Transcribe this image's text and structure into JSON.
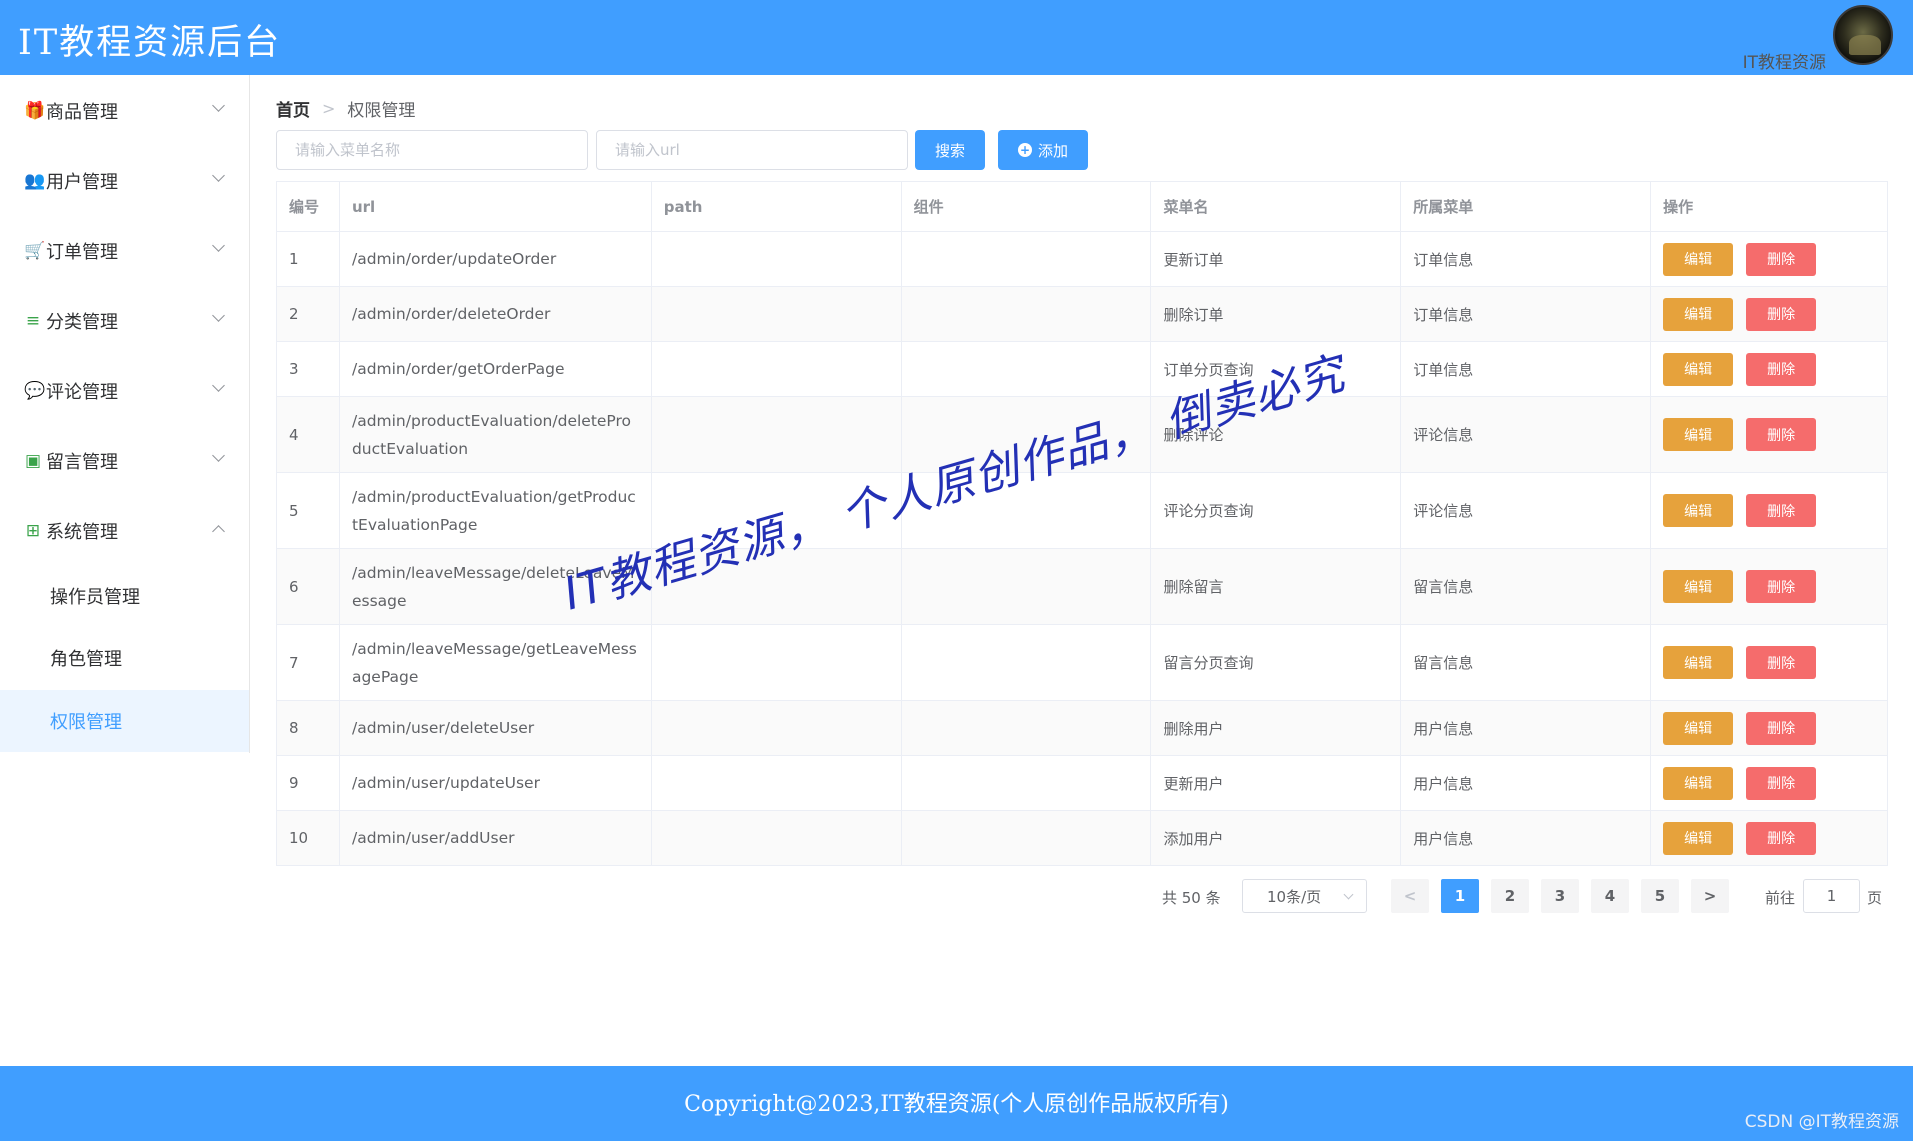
{
  "header": {
    "title": "IT教程资源后台",
    "user_name": "IT教程资源"
  },
  "sidebar": {
    "items": [
      {
        "label": "商品管理",
        "icon": "gift-icon",
        "glyph": "🎁"
      },
      {
        "label": "用户管理",
        "icon": "users-icon",
        "glyph": "👥"
      },
      {
        "label": "订单管理",
        "icon": "cart-icon",
        "glyph": "🛒"
      },
      {
        "label": "分类管理",
        "icon": "list-icon",
        "glyph": "≡"
      },
      {
        "label": "评论管理",
        "icon": "comment-icon",
        "glyph": "💬"
      },
      {
        "label": "留言管理",
        "icon": "message-icon",
        "glyph": "▣"
      },
      {
        "label": "系统管理",
        "icon": "windows-icon",
        "glyph": "⊞"
      }
    ],
    "sub_items": [
      {
        "label": "操作员管理"
      },
      {
        "label": "角色管理"
      },
      {
        "label": "权限管理"
      }
    ]
  },
  "breadcrumb": {
    "home": "首页",
    "separator": ">",
    "current": "权限管理"
  },
  "search": {
    "menu_placeholder": "请输入菜单名称",
    "url_placeholder": "请输入url",
    "search_label": "搜索",
    "add_label": "添加"
  },
  "table": {
    "columns": [
      "编号",
      "url",
      "path",
      "组件",
      "菜单名",
      "所属菜单",
      "操作"
    ],
    "edit_label": "编辑",
    "delete_label": "删除",
    "rows": [
      {
        "id": "1",
        "url": "/admin/order/updateOrder",
        "path": "",
        "component": "",
        "menu_name": "更新订单",
        "parent": "订单信息"
      },
      {
        "id": "2",
        "url": "/admin/order/deleteOrder",
        "path": "",
        "component": "",
        "menu_name": "删除订单",
        "parent": "订单信息"
      },
      {
        "id": "3",
        "url": "/admin/order/getOrderPage",
        "path": "",
        "component": "",
        "menu_name": "订单分页查询",
        "parent": "订单信息"
      },
      {
        "id": "4",
        "url": "/admin/productEvaluation/deleteProductEvaluation",
        "path": "",
        "component": "",
        "menu_name": "删除评论",
        "parent": "评论信息"
      },
      {
        "id": "5",
        "url": "/admin/productEvaluation/getProductEvaluationPage",
        "path": "",
        "component": "",
        "menu_name": "评论分页查询",
        "parent": "评论信息"
      },
      {
        "id": "6",
        "url": "/admin/leaveMessage/deleteLeaveMessage",
        "path": "",
        "component": "",
        "menu_name": "删除留言",
        "parent": "留言信息"
      },
      {
        "id": "7",
        "url": "/admin/leaveMessage/getLeaveMessagePage",
        "path": "",
        "component": "",
        "menu_name": "留言分页查询",
        "parent": "留言信息"
      },
      {
        "id": "8",
        "url": "/admin/user/deleteUser",
        "path": "",
        "component": "",
        "menu_name": "删除用户",
        "parent": "用户信息"
      },
      {
        "id": "9",
        "url": "/admin/user/updateUser",
        "path": "",
        "component": "",
        "menu_name": "更新用户",
        "parent": "用户信息"
      },
      {
        "id": "10",
        "url": "/admin/user/addUser",
        "path": "",
        "component": "",
        "menu_name": "添加用户",
        "parent": "用户信息"
      }
    ]
  },
  "pagination": {
    "total": "共 50 条",
    "page_size": "10条/页",
    "prev": "<",
    "next": ">",
    "pages": [
      "1",
      "2",
      "3",
      "4",
      "5"
    ],
    "current_page": "1",
    "goto_label": "前往",
    "goto_value": "1",
    "page_unit": "页"
  },
  "watermark": "IT教程资源，  个人原创作品，  倒卖必究",
  "footer": {
    "copyright": "Copyright@2023,IT教程资源(个人原创作品版权所有)",
    "csdn": "CSDN @IT教程资源"
  },
  "colors": {
    "primary": "#409eff",
    "warning": "#e6a23c",
    "danger": "#f56c6c",
    "watermark": "#2330b5"
  }
}
